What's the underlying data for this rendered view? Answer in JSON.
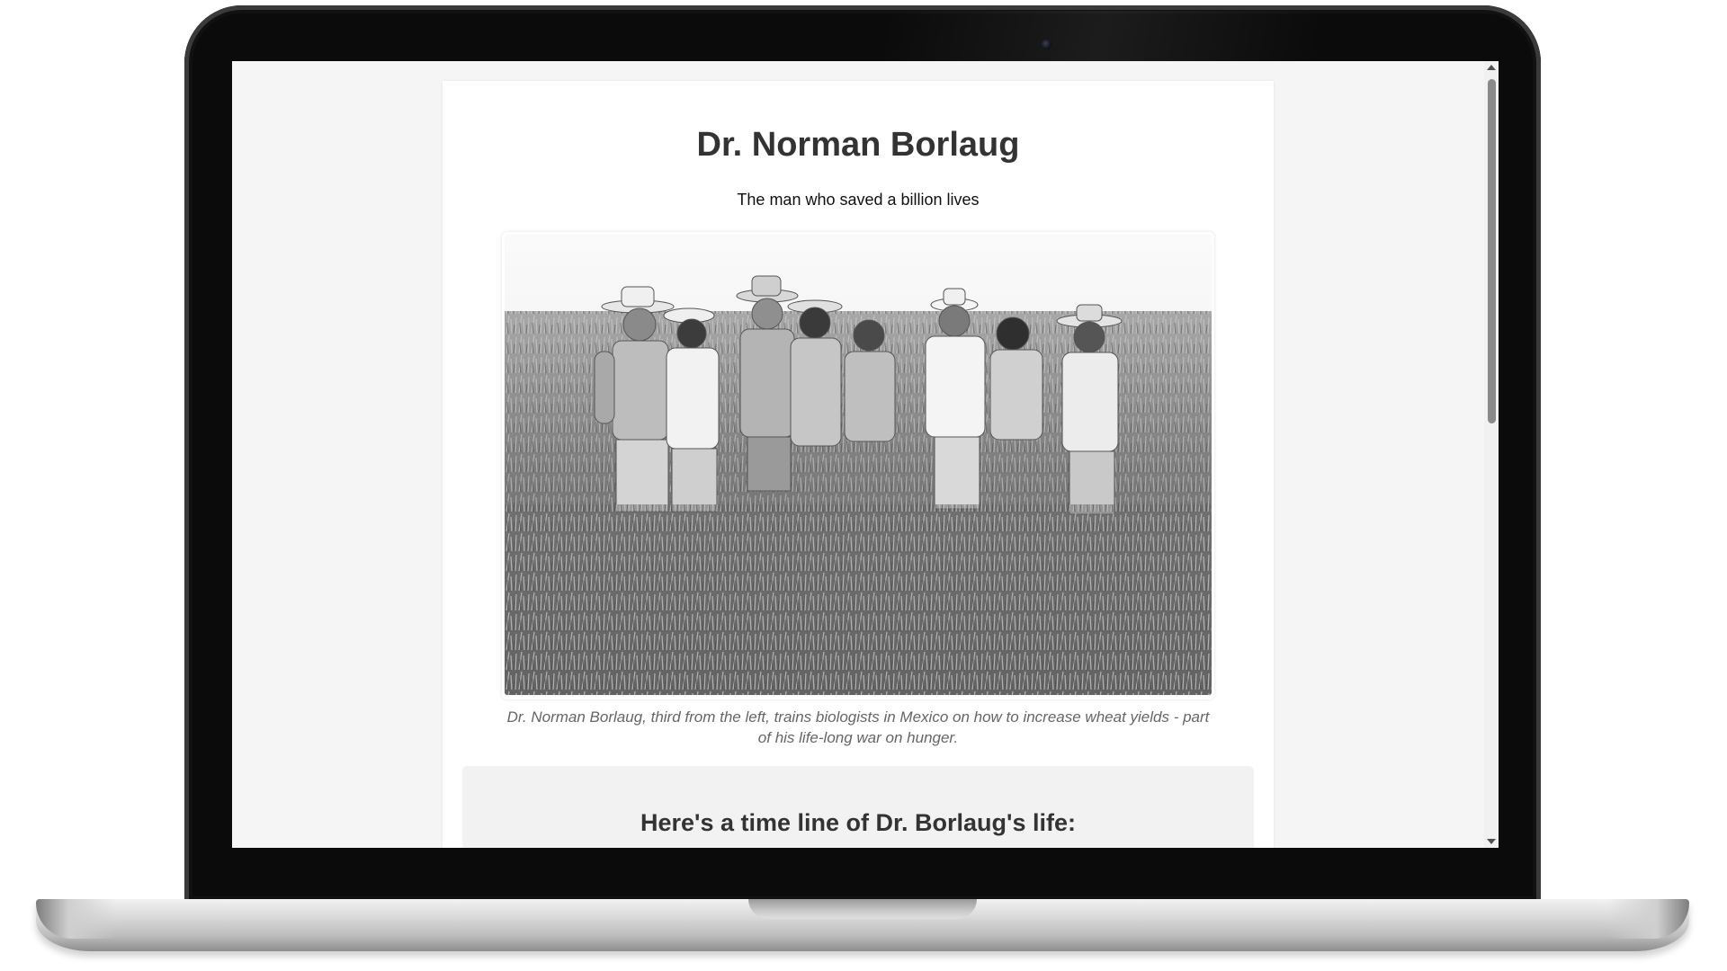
{
  "page": {
    "title": "Dr. Norman Borlaug",
    "subtitle": "The man who saved a billion lives",
    "image": {
      "description_name": "photo-borlaug-wheat-field",
      "caption": "Dr. Norman Borlaug, third from the left, trains biologists in Mexico on how to increase wheat yields - part of his life-long war on hunger."
    },
    "timeline": {
      "heading": "Here's a time line of Dr. Borlaug's life:"
    }
  },
  "colors": {
    "page_background": "#f5f5f5",
    "card_background": "#ffffff",
    "title_text": "#333333",
    "caption_text": "#666666",
    "timeline_background": "#f2f2f2"
  }
}
